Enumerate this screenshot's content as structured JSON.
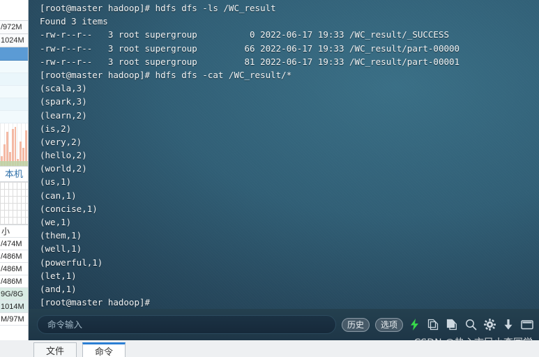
{
  "terminal": {
    "lines": [
      "[root@master hadoop]# hdfs dfs -ls /WC_result",
      "Found 3 items",
      "-rw-r--r--   3 root supergroup          0 2022-06-17 19:33 /WC_result/_SUCCESS",
      "-rw-r--r--   3 root supergroup         66 2022-06-17 19:33 /WC_result/part-00000",
      "-rw-r--r--   3 root supergroup         81 2022-06-17 19:33 /WC_result/part-00001",
      "[root@master hadoop]# hdfs dfs -cat /WC_result/*",
      "(scala,3)",
      "(spark,3)",
      "(learn,2)",
      "(is,2)",
      "(very,2)",
      "(hello,2)",
      "(world,2)",
      "(us,1)",
      "(can,1)",
      "(concise,1)",
      "(we,1)",
      "(them,1)",
      "(well,1)",
      "(powerful,1)",
      "(let,1)",
      "(and,1)",
      "[root@master hadoop]#"
    ]
  },
  "command_bar": {
    "input_value": "",
    "input_placeholder": "命令输入",
    "history_label": "历史",
    "options_label": "选项",
    "icons": [
      "lightning-icon",
      "clone-icon",
      "paste-icon",
      "search-icon",
      "gear-icon",
      "download-icon",
      "window-icon"
    ],
    "lightning_color": "#37d94a",
    "icon_color": "#cdd8e0"
  },
  "sidebar": {
    "metrics_top": [
      "/972M",
      "1024M"
    ],
    "host_label": "本机",
    "metrics_bottom": [
      "/474M",
      "/486M",
      "/486M",
      "/486M",
      "9G/8G",
      "1014M",
      "M/97M"
    ],
    "glyph_label": "小",
    "chart_bars": [
      14,
      30,
      48,
      20,
      52,
      55,
      10,
      34,
      26,
      50
    ]
  },
  "tabs": {
    "items": [
      {
        "label": "文件",
        "active": false
      },
      {
        "label": "命令",
        "active": true
      }
    ]
  },
  "watermark": {
    "text": "CSDN @热心市民小李同学"
  }
}
